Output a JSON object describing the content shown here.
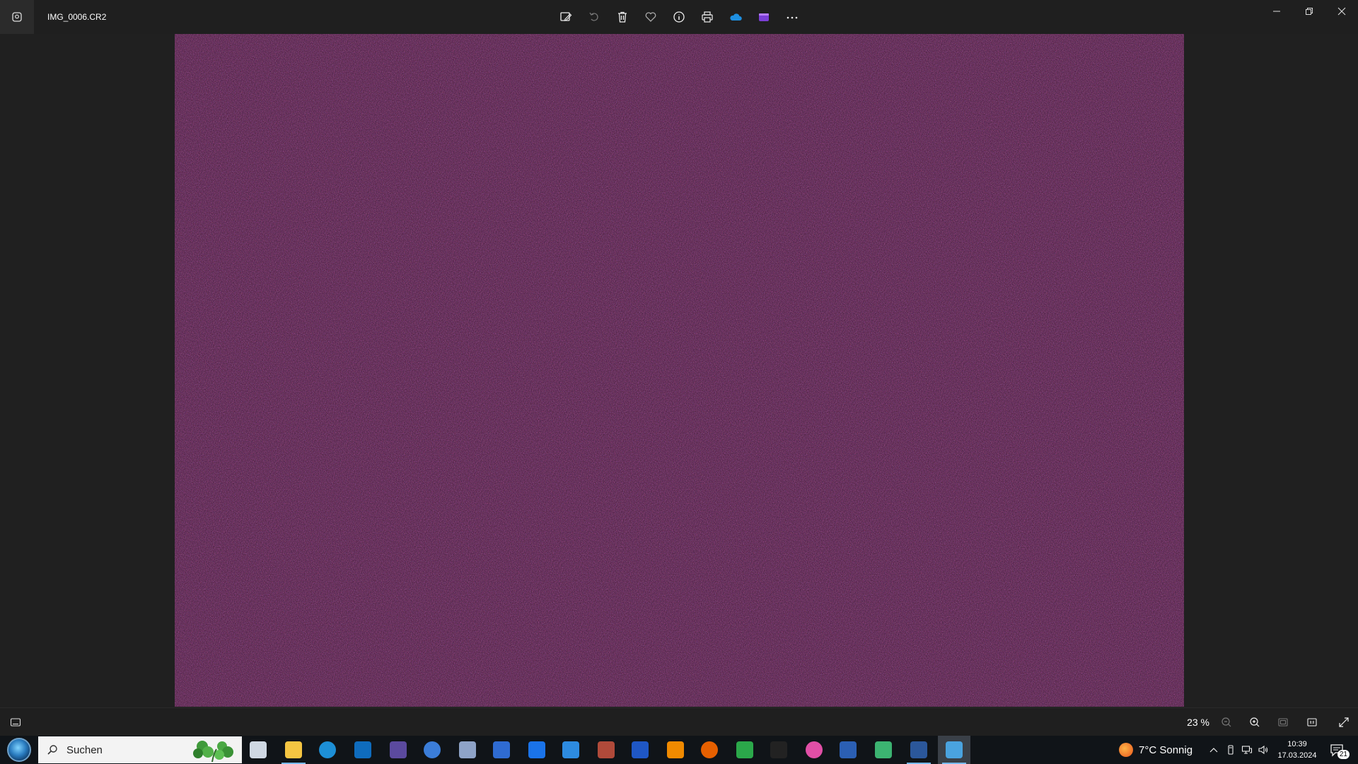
{
  "window": {
    "file_name": "IMG_0006.CR2"
  },
  "toolbar": {
    "buttons": [
      {
        "name": "edit-image-icon"
      },
      {
        "name": "rotate-icon"
      },
      {
        "name": "delete-icon"
      },
      {
        "name": "favorite-icon"
      },
      {
        "name": "info-icon"
      },
      {
        "name": "print-icon"
      },
      {
        "name": "onedrive-icon"
      },
      {
        "name": "clipchamp-icon"
      },
      {
        "name": "more-icon"
      }
    ]
  },
  "statusbar": {
    "zoom_label": "23 %"
  },
  "taskbar": {
    "search_placeholder": "Suchen",
    "weather_text": "7°C  Sonnig",
    "time": "10:39",
    "date": "17.03.2024",
    "notification_count": "21",
    "apps": [
      {
        "name": "task-view-icon",
        "color": "#cfd8e3"
      },
      {
        "name": "file-explorer-icon",
        "color": "#f5c542"
      },
      {
        "name": "edge-icon",
        "color": "#1d8fd6"
      },
      {
        "name": "outlook-icon",
        "color": "#0f6cbd"
      },
      {
        "name": "app-purple-icon",
        "color": "#5b4a9e"
      },
      {
        "name": "app-blue-circle-icon",
        "color": "#3b7dd8"
      },
      {
        "name": "app-image-icon",
        "color": "#8ea3c7"
      },
      {
        "name": "app-a-icon",
        "color": "#2f6bd1"
      },
      {
        "name": "teamviewer-icon",
        "color": "#1a73e8"
      },
      {
        "name": "app-camera-icon",
        "color": "#2d8be0"
      },
      {
        "name": "app-archive-icon",
        "color": "#b04a3a"
      },
      {
        "name": "app-triangle-icon",
        "color": "#1f57c4"
      },
      {
        "name": "vlc-icon",
        "color": "#f08a00"
      },
      {
        "name": "firefox-icon",
        "color": "#e66000"
      },
      {
        "name": "app-cards-icon",
        "color": "#2ba84a"
      },
      {
        "name": "ashampoo-icon",
        "color": "#222"
      },
      {
        "name": "itunes-icon",
        "color": "#e14fa6"
      },
      {
        "name": "app-globe-icon",
        "color": "#2b5fb3"
      },
      {
        "name": "app-bars-icon",
        "color": "#3cb371"
      },
      {
        "name": "word-icon",
        "color": "#2b579a"
      },
      {
        "name": "photos-icon",
        "color": "#4aa3df"
      }
    ]
  }
}
